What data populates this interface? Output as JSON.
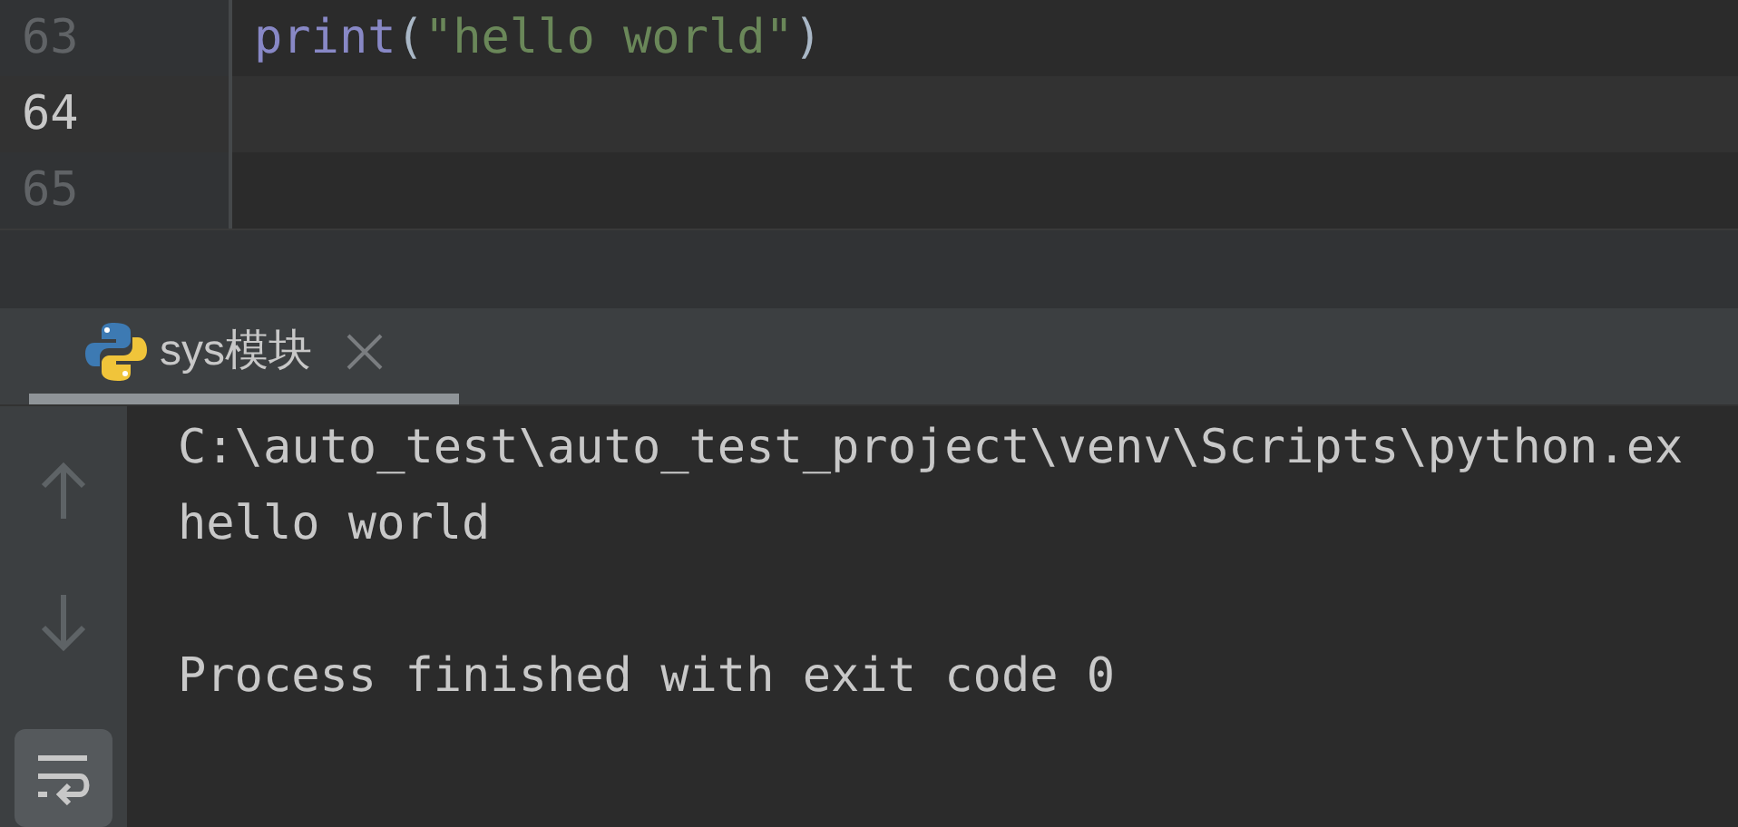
{
  "editor": {
    "lines": [
      {
        "number": "63",
        "current": false,
        "code": [
          {
            "kind": "function",
            "text": "print"
          },
          {
            "kind": "punct",
            "text": "("
          },
          {
            "kind": "string",
            "text": "\"hello world\""
          },
          {
            "kind": "punct",
            "text": ")"
          }
        ]
      },
      {
        "number": "64",
        "current": true
      },
      {
        "number": "65",
        "current": false
      }
    ]
  },
  "run_panel": {
    "tabs": [
      {
        "label": "sys模块",
        "selected": true
      }
    ],
    "toolbar": [
      {
        "kind": "up",
        "selected": false
      },
      {
        "kind": "down",
        "selected": false
      },
      {
        "kind": "soft-wrap",
        "selected": true
      }
    ],
    "console": [
      {
        "lines": [
          "C:\\auto_test\\auto_test_project\\venv\\Scripts\\python.ex",
          "hello world"
        ]
      },
      {
        "lines": [
          "Process finished with exit code 0"
        ]
      }
    ]
  }
}
